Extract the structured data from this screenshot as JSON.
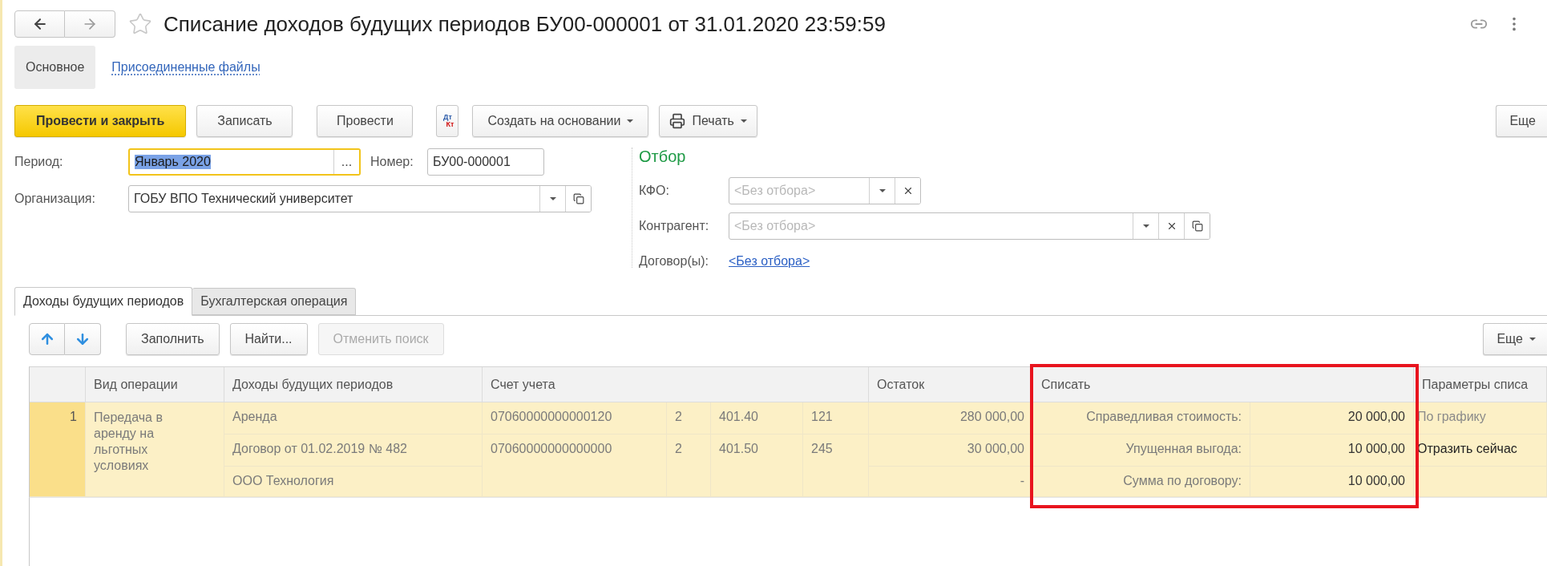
{
  "window": {
    "title": "Списание доходов будущих периодов БУ00-000001 от 31.01.2020 23:59:59"
  },
  "form_tabs": [
    {
      "label": "Основное",
      "selected": true
    },
    {
      "label": "Присоединенные файлы",
      "selected": false
    }
  ],
  "toolbar": {
    "buttons": [
      {
        "kind": "primary",
        "label": "Провести и закрыть"
      },
      {
        "kind": "plain",
        "label": "Записать"
      },
      {
        "kind": "plain",
        "label": "Провести"
      },
      {
        "kind": "dtkt",
        "top": "Дт",
        "bottom": "Кт"
      },
      {
        "kind": "dropdown",
        "label": "Создать на основании"
      },
      {
        "kind": "print",
        "label": "Печать"
      }
    ],
    "more": "Еще"
  },
  "fields": {
    "period": {
      "label": "Период:",
      "value": "Январь 2020",
      "focused": true,
      "choose": "..."
    },
    "number": {
      "label": "Номер:",
      "value": "БУ00-000001"
    },
    "organization": {
      "label": "Организация:",
      "value": "ГОБУ ВПО Технический университет"
    }
  },
  "filter": {
    "title": "Отбор",
    "kfo": {
      "label": "КФО:",
      "placeholder": "<Без отбора>"
    },
    "counterparty": {
      "label": "Контрагент:",
      "placeholder": "<Без отбора>"
    },
    "contracts": {
      "label": "Договор(ы):",
      "link": "<Без отбора>"
    }
  },
  "doc_tabs": [
    {
      "label": "Доходы будущих периодов",
      "selected": true
    },
    {
      "label": "Бухгалтерская операция",
      "selected": false
    }
  ],
  "table_toolbar": {
    "buttons": [
      {
        "label": "Заполнить",
        "disabled": false
      },
      {
        "label": "Найти...",
        "disabled": false
      },
      {
        "label": "Отменить поиск",
        "disabled": true
      }
    ],
    "more": "Еще"
  },
  "table": {
    "columns": [
      {
        "label": "Вид операции",
        "highlighted": false
      },
      {
        "label": "Доходы будущих периодов",
        "highlighted": false
      },
      {
        "label": "Счет учета",
        "highlighted": false
      },
      {
        "label": "Остаток",
        "highlighted": false
      },
      {
        "label": "Списать",
        "highlighted": true
      },
      {
        "label": "Параметры списа",
        "highlighted": false
      }
    ],
    "rows": [
      {
        "number": "1",
        "selected": true,
        "operation": "Передача в аренду на льготных условиях",
        "lines": [
          {
            "income": "Аренда",
            "account_parts": [
              "07060000000000120",
              "2",
              "401.40",
              "121"
            ],
            "balance": "280 000,00",
            "writeoff_label": "Справедливая стоимость:",
            "writeoff_amount": "20 000,00",
            "parameters": "По графику",
            "parameters_dimmed": true
          },
          {
            "income": "Договор от 01.02.2019 № 482",
            "account_parts": [
              "07060000000000000",
              "2",
              "401.50",
              "245"
            ],
            "balance": "30 000,00",
            "writeoff_label": "Упущенная выгода:",
            "writeoff_amount": "10 000,00",
            "parameters": "Отразить сейчас",
            "parameters_dimmed": false
          },
          {
            "income": "ООО Технология",
            "balance": "-",
            "writeoff_label": "Сумма по договору:",
            "writeoff_amount": "10 000,00"
          }
        ]
      }
    ]
  }
}
